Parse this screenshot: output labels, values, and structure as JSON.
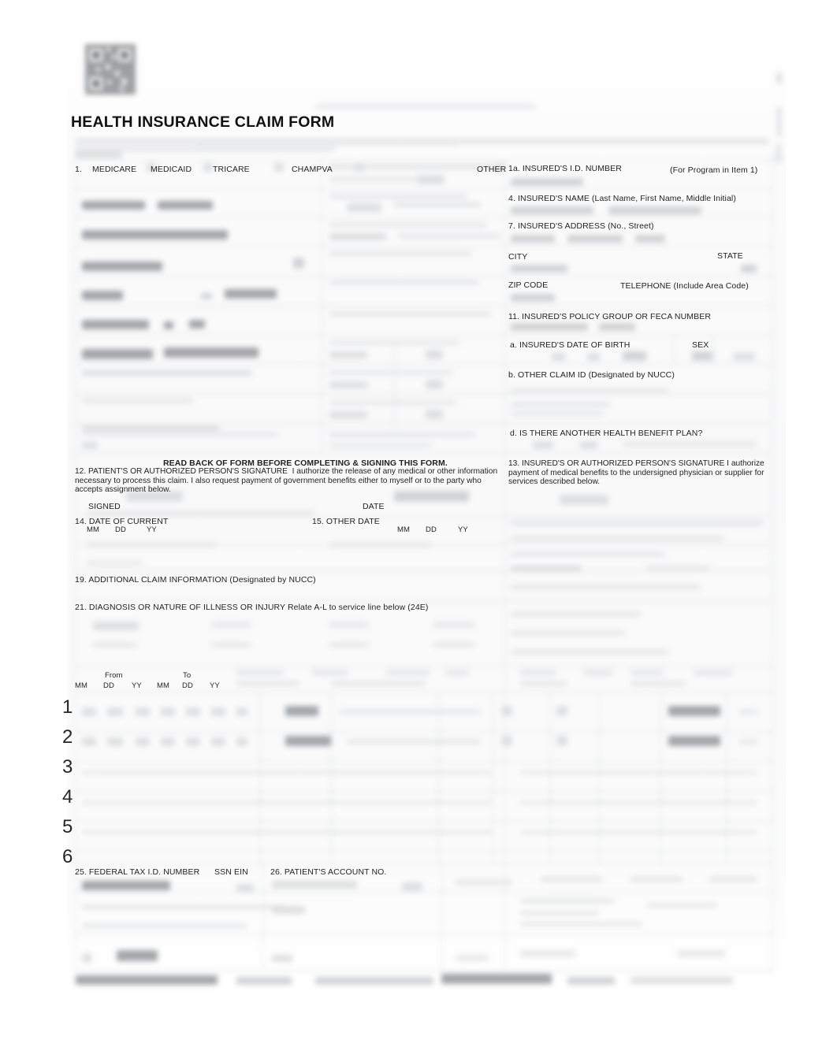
{
  "document": {
    "title": "HEALTH INSURANCE CLAIM FORM",
    "form_type": "CMS-1500 Health Insurance Claim Form",
    "condition": "scanned form, filled data redacted / blurred"
  },
  "header": {
    "barcode_label": "2d-barcode"
  },
  "carrier_section": {
    "item1_number": "1.",
    "program_options": [
      "MEDICARE",
      "MEDICAID",
      "TRICARE",
      "CHAMPVA",
      "OTHER"
    ],
    "item1a_label": "1a. INSURED'S I.D. NUMBER",
    "item1a_note": "(For Program in Item 1)"
  },
  "insured_column": [
    {
      "num": "4.",
      "label": "INSURED'S NAME (Last Name, First Name, Middle Initial)"
    },
    {
      "num": "7.",
      "label": "INSURED'S ADDRESS (No., Street)"
    }
  ],
  "address_labels": {
    "city": "CITY",
    "state": "STATE",
    "zip": "ZIP CODE",
    "telephone": "TELEPHONE (Include Area Code)"
  },
  "policy_section": {
    "item11": "11. INSURED'S POLICY GROUP OR FECA NUMBER",
    "item11a": "a. INSURED'S DATE OF BIRTH",
    "sex": "SEX",
    "item11b": "b. OTHER CLAIM ID (Designated by NUCC)",
    "item11d": "d. IS THERE ANOTHER HEALTH BENEFIT PLAN?"
  },
  "signature_section": {
    "read_back": "READ BACK OF FORM BEFORE COMPLETING & SIGNING THIS FORM.",
    "item12_num": "12.",
    "item12_head": "PATIENT'S OR AUTHORIZED PERSON'S SIGNATURE",
    "item12_body": "I authorize the release of any medical or other information necessary to process this claim. I also request payment of government benefits either to myself or to the party who accepts assignment below.",
    "signed": "SIGNED",
    "date": "DATE",
    "item13_num": "13.",
    "item13_head": "INSURED'S OR AUTHORIZED PERSON'S SIGNATURE",
    "item13_body": "I authorize payment of medical benefits to the undersigned physician or supplier for services described below."
  },
  "date_section": {
    "item14": "14. DATE OF CURRENT",
    "item15": "15. OTHER DATE",
    "mm": "MM",
    "dd": "DD",
    "yy": "YY"
  },
  "claim_info": {
    "item19": "19. ADDITIONAL CLAIM INFORMATION (Designated by NUCC)",
    "item21": "21. DIAGNOSIS OR NATURE OF ILLNESS OR INJURY Relate A-L to service line below (24E)"
  },
  "service_table": {
    "from": "From",
    "to": "To",
    "mm": "MM",
    "dd": "DD",
    "yy": "YY",
    "line_numbers": [
      "1",
      "2",
      "3",
      "4",
      "5",
      "6"
    ]
  },
  "footer_section": {
    "item25": "25. FEDERAL TAX I.D. NUMBER",
    "ssn": "SSN",
    "ein": "EIN",
    "item26": "26. PATIENT'S ACCOUNT NO."
  },
  "colors": {
    "page_background": "#ffffff",
    "scan_tint": "#f7f7f8",
    "text": "#1f1f20",
    "rule": "#d9dbdd",
    "smudge": "#b9bbbe"
  }
}
